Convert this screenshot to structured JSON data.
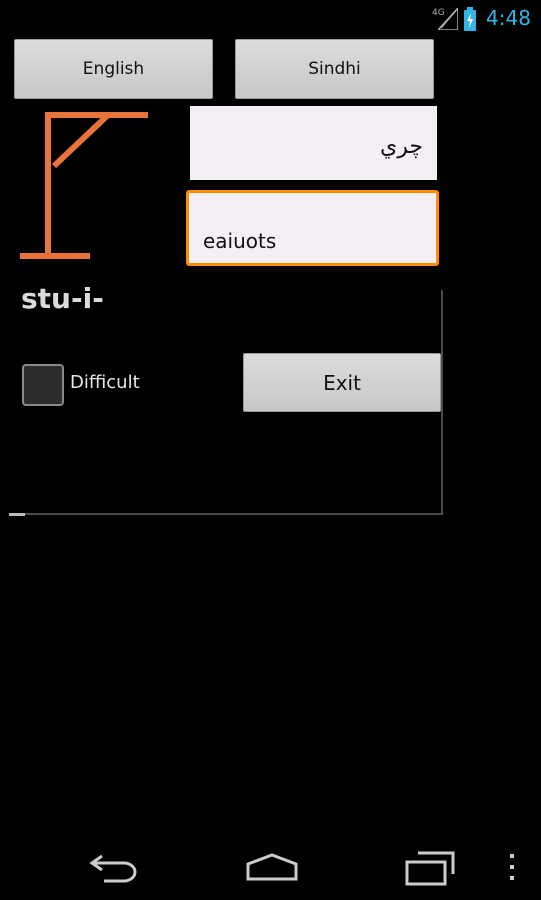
{
  "status_bar": {
    "network": "4G",
    "time": "4:48"
  },
  "buttons": {
    "english": "English",
    "sindhi": "Sindhi",
    "exit": "Exit"
  },
  "translation": {
    "sindhi_word": "چري"
  },
  "guess": {
    "input_value": "eaiuots"
  },
  "word_progress": "stu-i-",
  "difficulty": {
    "label": "Difficult",
    "checked": false
  },
  "colors": {
    "accent": "#ff8a00",
    "gallows": "#e8743b",
    "clock": "#33b5e5"
  },
  "icons": [
    "signal-icon",
    "battery-icon",
    "gallows-icon",
    "back-icon",
    "home-icon",
    "recents-icon",
    "overflow-menu-icon"
  ]
}
